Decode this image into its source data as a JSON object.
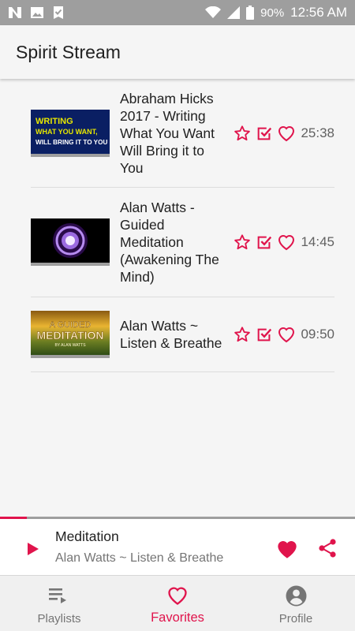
{
  "status_bar": {
    "battery": "90%",
    "time": "12:56 AM",
    "left_icons": [
      "n-icon",
      "image-icon",
      "check-badge-icon"
    ],
    "right_icons": [
      "wifi-icon",
      "signal-icon",
      "battery-icon"
    ]
  },
  "app_bar": {
    "title": "Spirit Stream"
  },
  "colors": {
    "accent": "#e0144c",
    "status_bar": "#9e9e9e",
    "thumb_1_text": "#e6e600"
  },
  "playlist": [
    {
      "title": "Abraham Hicks 2017 - Writing What You Want Will Bring it to You",
      "duration": "25:38",
      "thumb_lines": [
        "WRITING",
        "WHAT YOU WANT,",
        "WILL BRING IT TO YOU"
      ],
      "progress": 0
    },
    {
      "title": "Alan Watts - Guided Meditation (Awakening The Mind)",
      "duration": "14:45",
      "thumb_lines": [],
      "progress": 0.05
    },
    {
      "title": "Alan Watts ~ Listen & Breathe",
      "duration": "09:50",
      "thumb_lines": [
        "A GUIDED",
        "MEDITATION",
        "BY ALAN WATTS"
      ],
      "progress": 0.05
    }
  ],
  "now_playing": {
    "title": "Meditation",
    "subtitle": "Alan Watts ~ Listen & Breathe",
    "progress": 0.075
  },
  "bottom_nav": [
    {
      "label": "Playlists",
      "icon": "playlist-icon",
      "active": false
    },
    {
      "label": "Favorites",
      "icon": "heart-icon",
      "active": true
    },
    {
      "label": "Profile",
      "icon": "account-circle-icon",
      "active": false
    }
  ]
}
